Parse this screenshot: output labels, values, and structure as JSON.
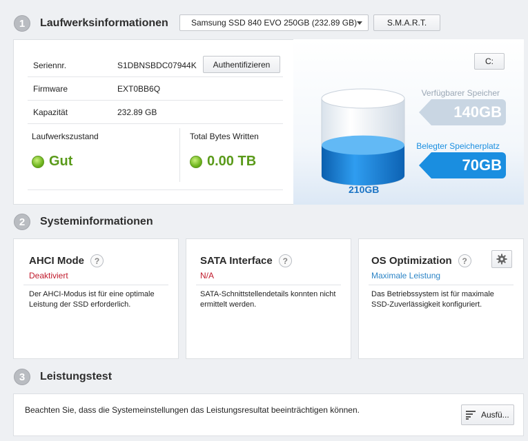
{
  "sections": {
    "drive_info": {
      "number": "1",
      "title": "Laufwerksinformationen"
    },
    "system_info": {
      "number": "2",
      "title": "Systeminformationen"
    },
    "perf_test": {
      "number": "3",
      "title": "Leistungstest"
    }
  },
  "toolbar": {
    "drive_selected": "Samsung SSD 840 EVO 250GB (232.89 GB)",
    "smart_label": "S.M.A.R.T."
  },
  "drive": {
    "serial_label": "Seriennr.",
    "serial_value": "S1DBNSBDC07944K",
    "auth_label": "Authentifizieren",
    "firmware_label": "Firmware",
    "firmware_value": "EXT0BB6Q",
    "capacity_label": "Kapazität",
    "capacity_value": "232.89 GB",
    "health_label": "Laufwerkszustand",
    "health_value": "Gut",
    "tbw_label": "Total Bytes Written",
    "tbw_value": "0.00 TB",
    "status_color": "#5a9a1a"
  },
  "storage": {
    "drive_letter": "C:",
    "available_label": "Verfügbarer Speicher",
    "available_value": "140GB",
    "used_label": "Belegter Speicherplatz",
    "used_value": "70GB",
    "total_label": "210GB",
    "used_fraction": 0.33,
    "used_color": "#1a8ee0",
    "available_color": "#c9d6e3"
  },
  "cards": [
    {
      "title": "AHCI Mode",
      "status": "Deaktiviert",
      "status_color": "#c0192b",
      "desc": "Der AHCI-Modus ist für eine optimale Leistung der SSD erforderlich."
    },
    {
      "title": "SATA Interface",
      "status": "N/A",
      "status_color": "#c0192b",
      "desc": "SATA-Schnittstellendetails konnten nicht ermittelt werden."
    },
    {
      "title": "OS Optimization",
      "status": "Maximale Leistung",
      "status_color": "#2b84c6",
      "desc": "Das Betriebssystem ist für maximale SSD-Zuverlässigkeit konfiguriert."
    }
  ],
  "help_glyph": "?",
  "perf": {
    "note": "Beachten Sie, dass die Systemeinstellungen das Leistungsresultat beeinträchtigen können.",
    "run_label": "Ausfü..."
  },
  "icons": [
    "chevron-down-icon",
    "help-icon",
    "gear-icon",
    "bars-icon",
    "status-ok-icon",
    "cylinder-icon"
  ]
}
